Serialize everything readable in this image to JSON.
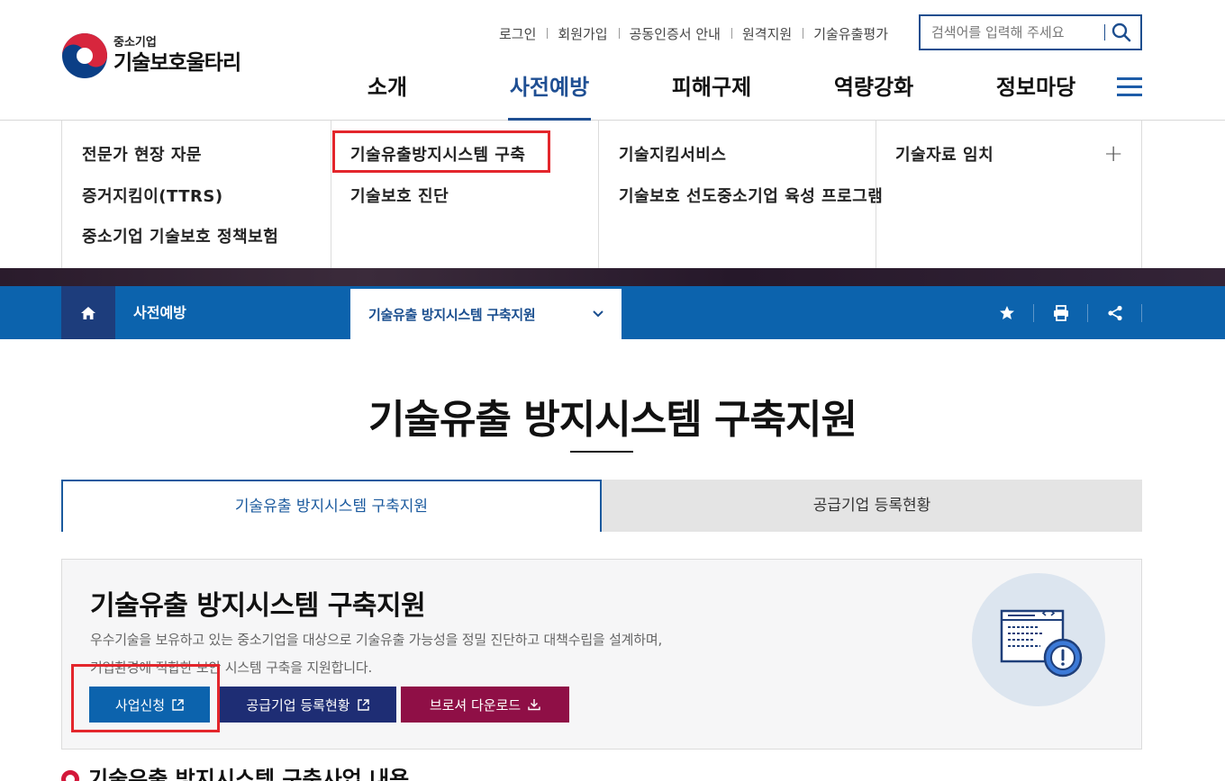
{
  "header": {
    "logo_sub": "중소기업",
    "logo_main": "기술보호울타리",
    "util_links": [
      "로그인",
      "회원가입",
      "공동인증서 안내",
      "원격지원",
      "기술유출평가"
    ],
    "search_placeholder": "검색어를 입력해 주세요",
    "gnb": [
      "소개",
      "사전예방",
      "피해구제",
      "역량강화",
      "정보마당"
    ],
    "gnb_active": "사전예방"
  },
  "mega_menu": {
    "col1": [
      "전문가 현장 자문",
      "증거지킴이(TTRS)",
      "중소기업 기술보호 정책보험"
    ],
    "col2": [
      "기술유출방지시스템 구축",
      "기술보호 진단"
    ],
    "col3": [
      "기술지킴서비스",
      "기술보호 선도중소기업 육성 프로그램"
    ],
    "col4": [
      "기술자료 임치"
    ],
    "more": "+"
  },
  "location": {
    "level1": "사전예방",
    "level2": "기술유출 방지시스템 구축지원"
  },
  "page": {
    "title": "기술유출 방지시스템 구축지원",
    "tabs": [
      "기술유출 방지시스템 구축지원",
      "공급기업 등록현황"
    ],
    "active_tab": 0
  },
  "info": {
    "title": "기술유출 방지시스템 구축지원",
    "desc_line1": "우수기술을 보유하고 있는 중소기업을 대상으로 기술유출 가능성을 정밀 진단하고 대책수립을 설계하며,",
    "desc_line2": "기업환경에 적합한 보안 시스템 구축을 지원합니다.",
    "btn_apply": "사업신청",
    "btn_status": "공급기업 등록현황",
    "btn_download": "브로셔 다운로드"
  },
  "next_section": {
    "title": "기술유출 방지시스템 구축사업 내용"
  },
  "colors": {
    "primary": "#0c63ad",
    "navy": "#1e2d74",
    "wine": "#8f0f46",
    "highlight": "#e3262c",
    "accent_red": "#d3183a"
  }
}
